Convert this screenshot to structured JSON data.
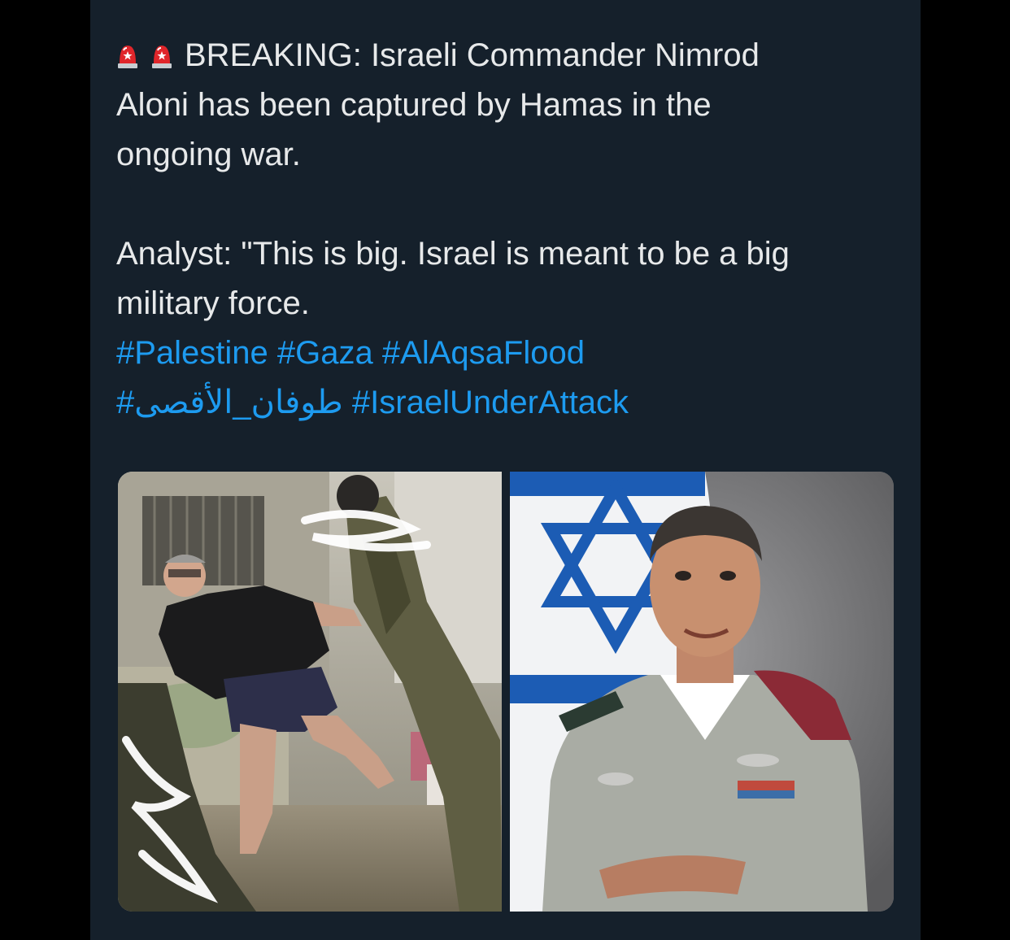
{
  "tweet": {
    "icons": [
      "police-light-emoji",
      "police-light-emoji"
    ],
    "lines": [
      "BREAKING: Israeli Commander Nimrod",
      "Aloni has been captured by Hamas in the",
      "ongoing war.",
      "Analyst: \"This is big. Israel is meant to be a big",
      "military force."
    ],
    "hashtags": {
      "palestine": "#Palestine",
      "gaza": "#Gaza",
      "alaqsaflood": "#AlAqsaFlood",
      "arabic": "#طوفان_الأقصى",
      "israelunderattack": "#IsraelUnderAttack"
    }
  },
  "colors": {
    "background": "#000000",
    "card": "#15202b",
    "text": "#e7e9ea",
    "link": "#1d9bf0"
  },
  "media": {
    "left_photo": "photo-captured-man",
    "right_photo": "photo-officer-portrait"
  }
}
